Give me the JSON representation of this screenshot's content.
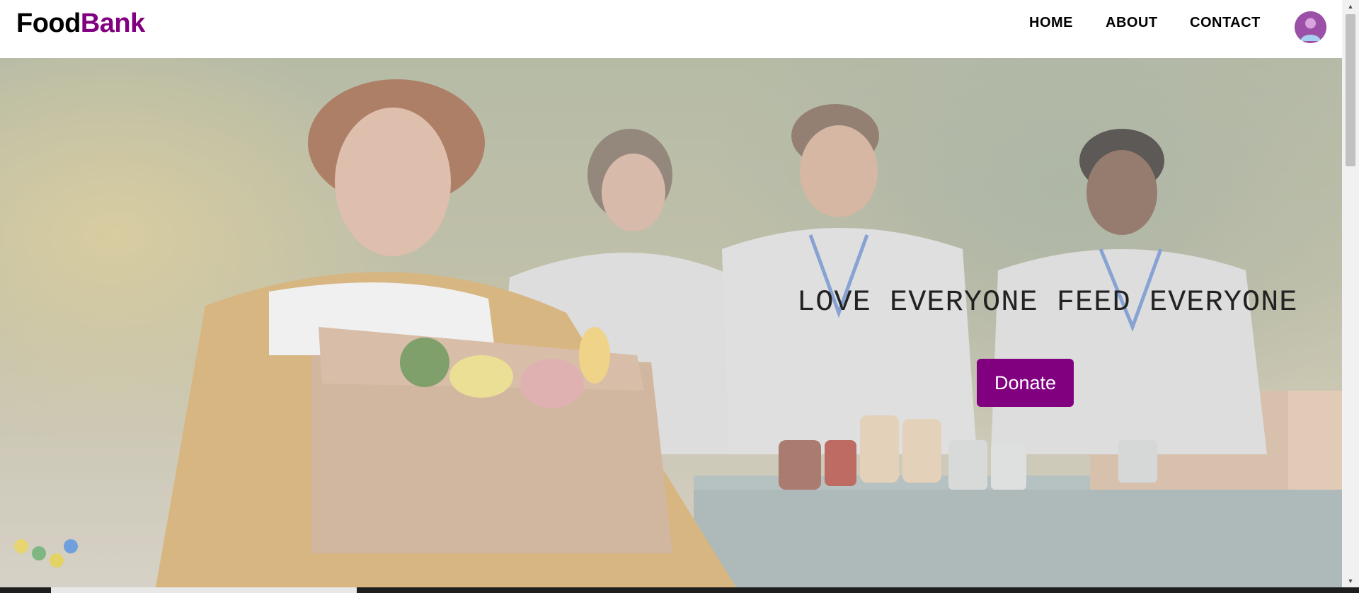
{
  "brand": {
    "logo_part1": "Food",
    "logo_part2": "Bank",
    "accent_color": "#800080"
  },
  "nav": {
    "items": [
      {
        "label": "HOME"
      },
      {
        "label": "ABOUT"
      },
      {
        "label": "CONTACT"
      }
    ],
    "avatar_icon": "user-avatar-icon"
  },
  "hero": {
    "headline": "LOVE EVERYONE FEED EVERYONE",
    "donate_label": "Donate",
    "image_alt": "hero-photo-volunteers-food-donation"
  },
  "scrollbar": {
    "up_icon": "▲",
    "down_icon": "▼"
  }
}
